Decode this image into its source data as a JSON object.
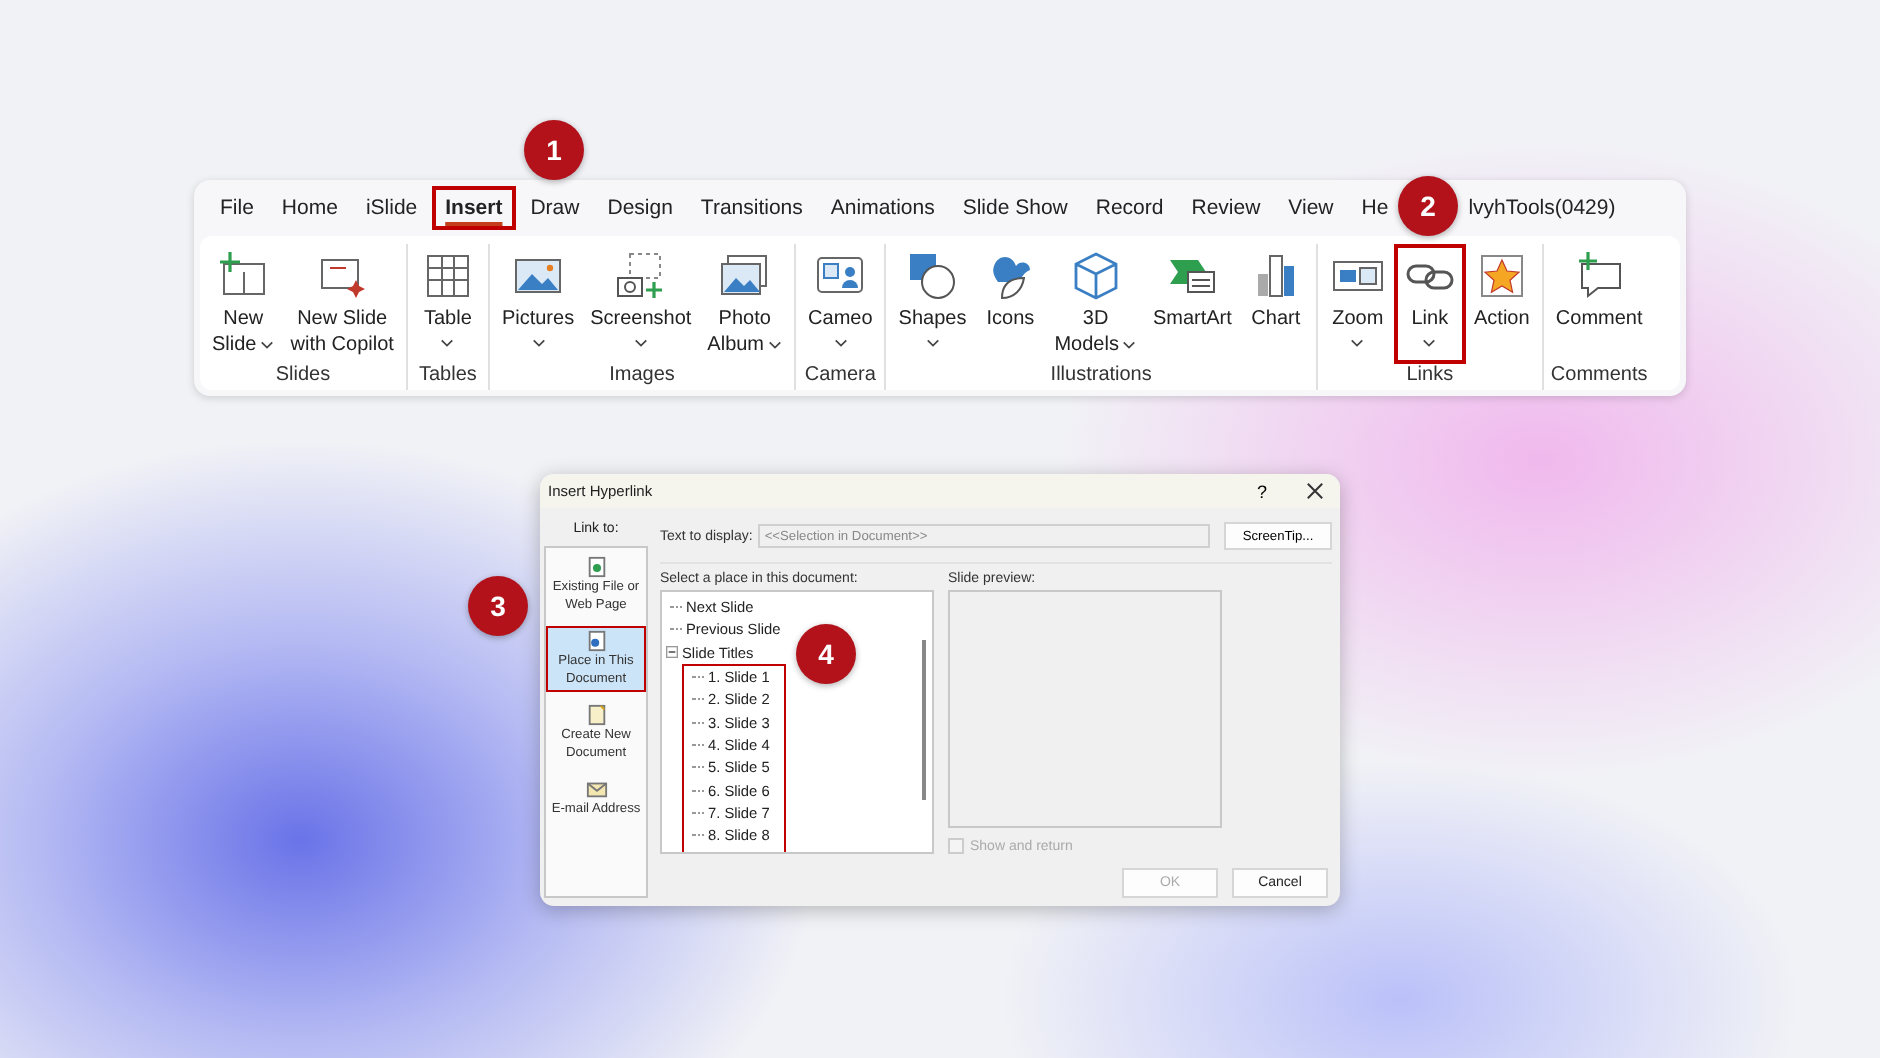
{
  "ribbon": {
    "tabs": [
      {
        "label": "File",
        "selected": false,
        "highlighted": false
      },
      {
        "label": "Home",
        "selected": false,
        "highlighted": false
      },
      {
        "label": "iSlide",
        "selected": false,
        "highlighted": false
      },
      {
        "label": "Insert",
        "selected": true,
        "highlighted": true
      },
      {
        "label": "Draw",
        "selected": false,
        "highlighted": false
      },
      {
        "label": "Design",
        "selected": false,
        "highlighted": false
      },
      {
        "label": "Transitions",
        "selected": false,
        "highlighted": false
      },
      {
        "label": "Animations",
        "selected": false,
        "highlighted": false
      },
      {
        "label": "Slide Show",
        "selected": false,
        "highlighted": false
      },
      {
        "label": "Record",
        "selected": false,
        "highlighted": false
      },
      {
        "label": "Review",
        "selected": false,
        "highlighted": false
      },
      {
        "label": "View",
        "selected": false,
        "highlighted": false
      },
      {
        "label": "He",
        "selected": false,
        "highlighted": false
      },
      {
        "label": "lvyhTools(0429)",
        "selected": false,
        "highlighted": false
      }
    ],
    "groups": [
      {
        "label": "Slides",
        "commands": [
          {
            "kind": "new-slide",
            "lines": [
              "New",
              "Slide"
            ],
            "dropdown": true,
            "highlighted": false
          },
          {
            "kind": "copilot",
            "lines": [
              "New Slide",
              "with Copilot"
            ],
            "dropdown": false,
            "highlighted": false
          }
        ]
      },
      {
        "label": "Tables",
        "commands": [
          {
            "kind": "table",
            "lines": [
              "Table"
            ],
            "dropdown": true,
            "highlighted": false
          }
        ]
      },
      {
        "label": "Images",
        "commands": [
          {
            "kind": "picture",
            "lines": [
              "Pictures"
            ],
            "dropdown": true,
            "highlighted": false
          },
          {
            "kind": "screenshot",
            "lines": [
              "Screenshot"
            ],
            "dropdown": true,
            "highlighted": false
          },
          {
            "kind": "album",
            "lines": [
              "Photo",
              "Album"
            ],
            "dropdown": true,
            "highlighted": false
          }
        ]
      },
      {
        "label": "Camera",
        "commands": [
          {
            "kind": "cameo",
            "lines": [
              "Cameo"
            ],
            "dropdown": true,
            "highlighted": false
          }
        ]
      },
      {
        "label": "Illustrations",
        "commands": [
          {
            "kind": "shapes",
            "lines": [
              "Shapes"
            ],
            "dropdown": true,
            "highlighted": false
          },
          {
            "kind": "icons",
            "lines": [
              "Icons"
            ],
            "dropdown": false,
            "highlighted": false
          },
          {
            "kind": "model",
            "lines": [
              "3D",
              "Models"
            ],
            "dropdown": true,
            "highlighted": false
          },
          {
            "kind": "smartart",
            "lines": [
              "SmartArt"
            ],
            "dropdown": false,
            "highlighted": false
          },
          {
            "kind": "chart",
            "lines": [
              "Chart"
            ],
            "dropdown": false,
            "highlighted": false
          }
        ]
      },
      {
        "label": "Links",
        "commands": [
          {
            "kind": "zoom",
            "lines": [
              "Zoom"
            ],
            "dropdown": true,
            "highlighted": false
          },
          {
            "kind": "link",
            "lines": [
              "Link"
            ],
            "dropdown": true,
            "highlighted": true
          },
          {
            "kind": "action",
            "lines": [
              "Action"
            ],
            "dropdown": false,
            "highlighted": false
          }
        ]
      },
      {
        "label": "Comments",
        "commands": [
          {
            "kind": "comment",
            "lines": [
              "Comment"
            ],
            "dropdown": false,
            "highlighted": false
          }
        ]
      }
    ]
  },
  "dialog": {
    "title": "Insert Hyperlink",
    "help_button": "?",
    "link_to_label": "Link to:",
    "link_targets": [
      {
        "kind": "file",
        "label": "Existing File or Web Page",
        "selected": false,
        "highlighted": false
      },
      {
        "kind": "place",
        "label": "Place in This Document",
        "selected": true,
        "highlighted": true
      },
      {
        "kind": "new",
        "label": "Create New Document",
        "selected": false,
        "highlighted": false
      },
      {
        "kind": "email",
        "label": "E-mail Address",
        "selected": false,
        "highlighted": false
      }
    ],
    "text_to_display": {
      "label": "Text to display:",
      "value": "<<Selection in Document>>",
      "disabled": true
    },
    "screentip_button": "ScreenTip...",
    "place_label": "Select a place in this document:",
    "tree": [
      {
        "label": "Next Slide"
      },
      {
        "label": "Previous Slide"
      },
      {
        "label": "Slide Titles",
        "expanded": true,
        "highlighted": true,
        "children": [
          {
            "label": "1. Slide 1"
          },
          {
            "label": "2. Slide 2"
          },
          {
            "label": "3. Slide 3"
          },
          {
            "label": "4. Slide 4"
          },
          {
            "label": "5. Slide 5"
          },
          {
            "label": "6. Slide 6"
          },
          {
            "label": "7. Slide 7"
          },
          {
            "label": "8. Slide 8"
          }
        ]
      }
    ],
    "preview_label": "Slide preview:",
    "show_and_return": {
      "label": "Show and return",
      "checked": false,
      "disabled": true
    },
    "buttons": [
      {
        "label": "OK",
        "disabled": true
      },
      {
        "label": "Cancel",
        "disabled": false
      }
    ]
  },
  "callouts": [
    {
      "number": "1"
    },
    {
      "number": "2"
    },
    {
      "number": "3"
    },
    {
      "number": "4"
    }
  ]
}
